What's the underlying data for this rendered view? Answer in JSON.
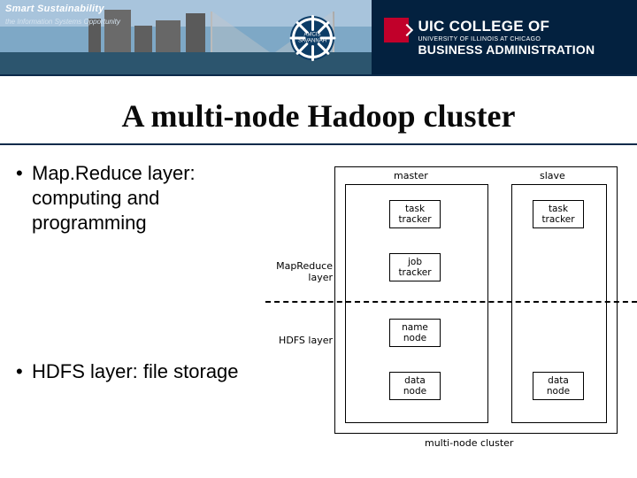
{
  "banner": {
    "smart": "Smart Sustainability",
    "sub": "the Information Systems Opportunity",
    "seal_line1": "AMCIS",
    "seal_line2": "SAVANNAH",
    "uic_brand": "UIC",
    "uic_college": "COLLEGE OF",
    "uic_univ": "UNIVERSITY OF ILLINOIS AT CHICAGO",
    "uic_dept": "BUSINESS ADMINISTRATION"
  },
  "title": "A multi-node Hadoop cluster",
  "bullets": {
    "b1": "Map.Reduce layer: computing and programming",
    "b2": "HDFS layer: file storage"
  },
  "diagram": {
    "cluster": "multi-node cluster",
    "master": "master",
    "slave": "slave",
    "mapreduce_layer": "MapReduce layer",
    "hdfs_layer": "HDFS layer",
    "task_tracker": "task tracker",
    "job_tracker": "job tracker",
    "name_node": "name node",
    "data_node": "data node"
  }
}
